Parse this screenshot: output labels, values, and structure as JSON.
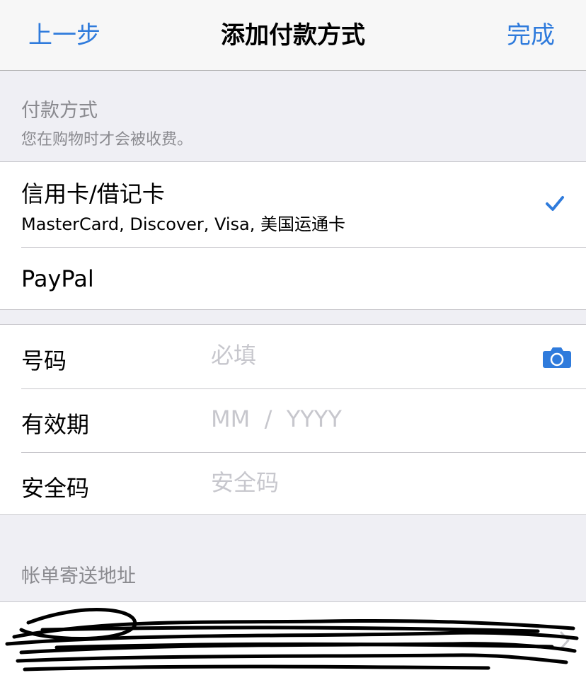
{
  "nav": {
    "back_label": "上一步",
    "title": "添加付款方式",
    "done_label": "完成"
  },
  "payment_section": {
    "title": "付款方式",
    "subtitle": "您在购物时才会被收费。"
  },
  "payment_methods": [
    {
      "title": "信用卡/借记卡",
      "subtitle": "MasterCard, Discover, Visa, 美国运通卡",
      "selected": true
    },
    {
      "title": "PayPal",
      "subtitle": "",
      "selected": false
    }
  ],
  "card_fields": {
    "number": {
      "label": "号码",
      "placeholder": "必填"
    },
    "expiry": {
      "label": "有效期",
      "placeholder": "MM  /  YYYY"
    },
    "security": {
      "label": "安全码",
      "placeholder": "安全码"
    }
  },
  "billing_section": {
    "title": "帐单寄送地址"
  },
  "colors": {
    "accent": "#2f7bdc",
    "background": "#efeff4",
    "placeholder": "#c7c7cd"
  }
}
